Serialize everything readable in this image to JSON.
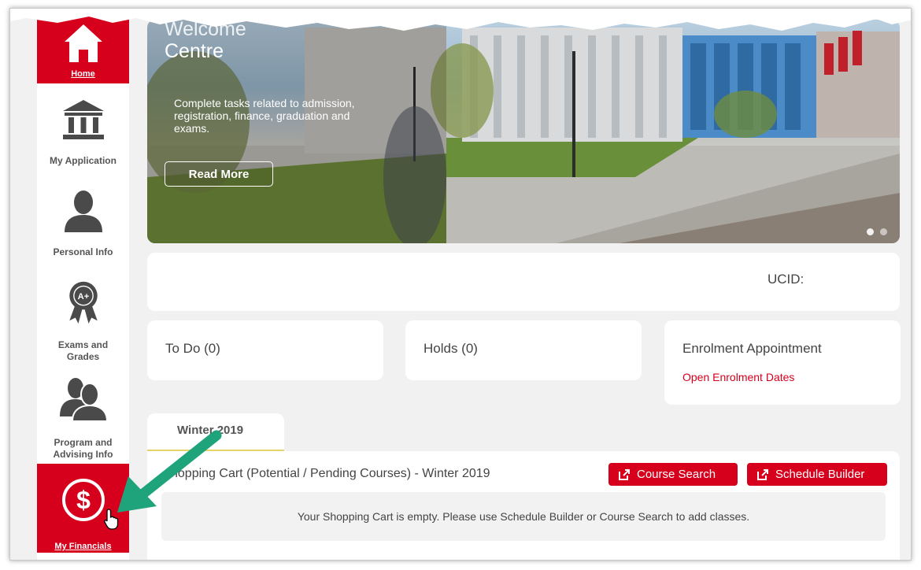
{
  "sidebar": {
    "items": [
      {
        "label": "Home",
        "icon": "home-icon",
        "active": true
      },
      {
        "label": "My Application",
        "icon": "pillars-icon"
      },
      {
        "label": "Personal Info",
        "icon": "person-icon"
      },
      {
        "label": "Exams and Grades",
        "icon": "award-ribbon-icon",
        "badge": "A+"
      },
      {
        "label": "Program and Advising Info",
        "icon": "people-icon"
      },
      {
        "label": "My Financials",
        "icon": "dollar-icon",
        "active": true
      }
    ]
  },
  "hero": {
    "title_line1": "Welcome",
    "title_line2": "Centre",
    "text": "Complete tasks related to admission, registration, finance, graduation and exams.",
    "read_more": "Read More"
  },
  "profile": {
    "ucid_label": "UCID:"
  },
  "todo": {
    "title": "To Do (0)"
  },
  "holds": {
    "title": "Holds (0)"
  },
  "enrolment": {
    "title": "Enrolment Appointment",
    "link": "Open Enrolment Dates"
  },
  "tabs": [
    {
      "label": "Winter 2019"
    }
  ],
  "cart": {
    "title": "hopping Cart (Potential / Pending Courses) - Winter 2019",
    "course_search": "Course Search",
    "schedule_builder": "Schedule Builder",
    "empty_message": "Your Shopping Cart is empty. Please use Schedule Builder or Course Search to add classes."
  },
  "colors": {
    "brand_red": "#d6001c",
    "annotation_arrow": "#1fa37a"
  }
}
